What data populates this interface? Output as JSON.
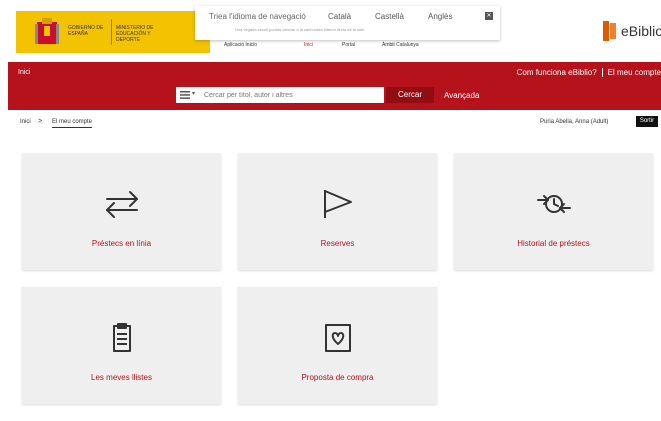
{
  "header": {
    "gov_text": "GOBIERNO DE ESPAÑA",
    "ministry_text": "MINISTERIO DE EDUCACIÓN Y DEPORTE",
    "language_bar": {
      "label": "Triea l'idioma de navegació",
      "languages": [
        "Català",
        "Castellà",
        "Anglès"
      ],
      "note": "Una vegada escull podràs canviar a la cantonada inferior dreta de la web"
    },
    "ministry_links": [
      "Aplicació Inicio",
      "Inici",
      "Portal",
      "Àmbit Catalunya"
    ],
    "brand": "eBiblio"
  },
  "nav": {
    "home": "Inici",
    "help_link": "Com funciona eBiblio?",
    "account_link": "El meu compte",
    "search_placeholder": "Cercar per títol, autor i altres",
    "search_button": "Cercar",
    "advanced_link": "Avançada"
  },
  "breadcrumb": {
    "home": "Inici",
    "separator": ">",
    "current": "El meu compte"
  },
  "user": {
    "name": "Puria Abella, Anna (Adult)",
    "logout": "Sortir"
  },
  "tiles": [
    {
      "label": "Préstecs en línia",
      "icon": "swap-arrows-icon"
    },
    {
      "label": "Reserves",
      "icon": "flag-icon"
    },
    {
      "label": "Historial de préstecs",
      "icon": "history-clock-icon"
    },
    {
      "label": "Les meves llistes",
      "icon": "clipboard-list-icon"
    },
    {
      "label": "Proposta de compra",
      "icon": "heart-box-icon"
    }
  ],
  "colors": {
    "accent": "#b5121b",
    "gov_yellow": "#f3c200",
    "tile_bg": "#efefef"
  }
}
